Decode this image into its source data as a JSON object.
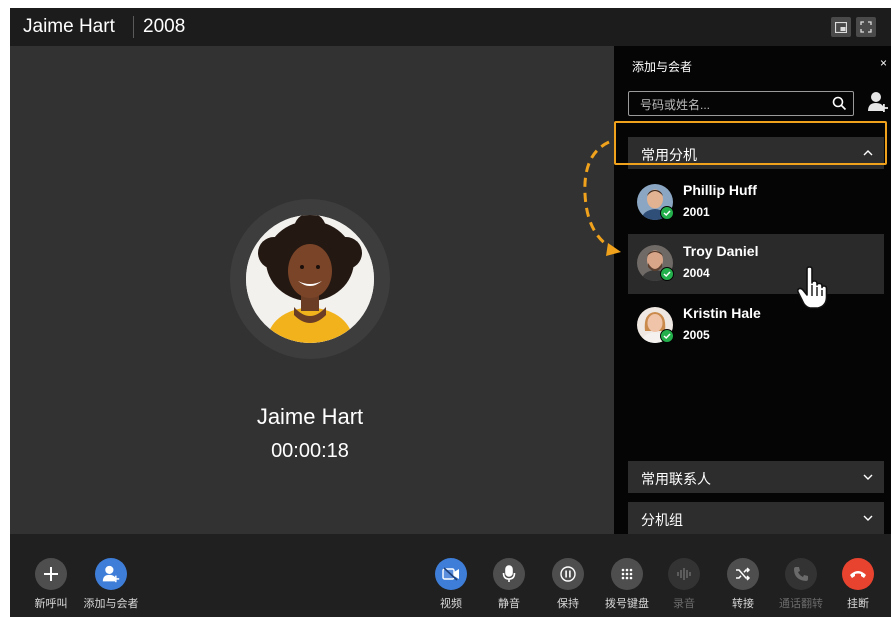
{
  "title_bar": {
    "caller_name": "Jaime Hart",
    "extension": "2008",
    "buttons": [
      {
        "icon": "picture-in-picture-icon"
      },
      {
        "icon": "fullscreen-icon"
      }
    ]
  },
  "call": {
    "caller_name": "Jaime Hart",
    "duration": "00:00:18",
    "avatar_icon": "caller-avatar"
  },
  "panel": {
    "title": "添加与会者",
    "close": "×",
    "search_placeholder": "号码或姓名...",
    "sections": {
      "favorites": "常用分机",
      "contacts": "常用联系人",
      "groups": "分机组"
    },
    "extensions": [
      {
        "name": "Phillip Huff",
        "ext": "2001",
        "status": "available"
      },
      {
        "name": "Troy Daniel",
        "ext": "2004",
        "status": "available"
      },
      {
        "name": "Kristin Hale",
        "ext": "2005",
        "status": "available"
      }
    ]
  },
  "toolbar": {
    "new_call": "新呼叫",
    "add_participant": "添加与会者",
    "video": "视频",
    "mute": "静音",
    "hold": "保持",
    "keypad": "拨号键盘",
    "record": "录音",
    "transfer": "转接",
    "flip": "通话翻转",
    "hangup": "挂断"
  },
  "colors": {
    "highlight": "#f0a21c",
    "online": "#23b04c",
    "hangup": "#e8432f",
    "accent_blue": "#3e7ed8"
  }
}
